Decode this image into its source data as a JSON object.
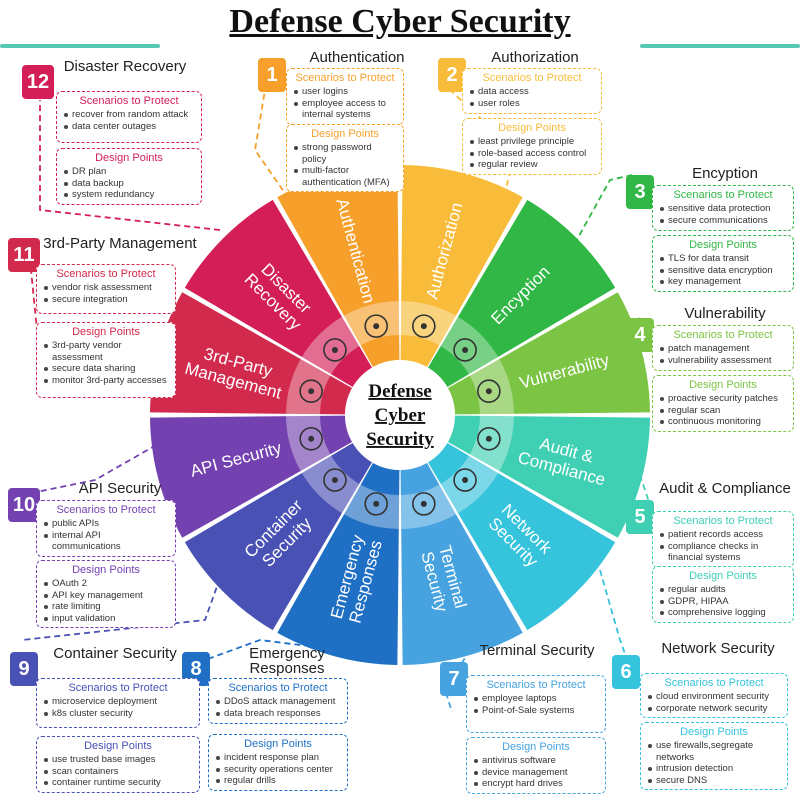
{
  "title": "Defense Cyber Security",
  "center_label": [
    "Defense",
    "Cyber",
    "Security"
  ],
  "sections": [
    {
      "num": "1",
      "name": "Authentication",
      "wheel": [
        "Authentication"
      ],
      "color": "#f6a02b",
      "scenarios_label": "Scenarios to Protect",
      "scenarios": [
        "user logins",
        "employee access to internal systems"
      ],
      "design_label": "Design Points",
      "design": [
        "strong password policy",
        "multi-factor authentication (MFA)"
      ]
    },
    {
      "num": "2",
      "name": "Authorization",
      "wheel": [
        "Authorization"
      ],
      "color": "#f8bc3a",
      "scenarios_label": "Scenarios to Protect",
      "scenarios": [
        "data access",
        "user roles"
      ],
      "design_label": "Design Points",
      "design": [
        "least privilege principle",
        "role-based access control",
        "regular review"
      ]
    },
    {
      "num": "3",
      "name": "Encyption",
      "wheel": [
        "Encyption"
      ],
      "color": "#30b745",
      "scenarios_label": "Scenarios to Protect",
      "scenarios": [
        "sensitive data protection",
        "secure communications"
      ],
      "design_label": "Design Points",
      "design": [
        "TLS for data transit",
        "sensitive data encryption",
        "key management"
      ]
    },
    {
      "num": "4",
      "name": "Vulnerability",
      "wheel": [
        "Vulnerability"
      ],
      "color": "#7cc443",
      "scenarios_label": "Scenarios to Protect",
      "scenarios": [
        "patch management",
        "vulnerability assessment"
      ],
      "design_label": "Design Points",
      "design": [
        "proactive security patches",
        "regular scan",
        "continuous monitoring"
      ]
    },
    {
      "num": "5",
      "name": "Audit & Compliance",
      "wheel": [
        "Audit &",
        "Compliance"
      ],
      "color": "#3fcfb3",
      "scenarios_label": "Scenarios to Protect",
      "scenarios": [
        "patient records access",
        "compliance checks in financial systems"
      ],
      "design_label": "Design Points",
      "design": [
        "regular audits",
        "GDPR, HIPAA",
        "comprehensive logging"
      ]
    },
    {
      "num": "6",
      "name": "Network Security",
      "wheel": [
        "Network",
        "Security"
      ],
      "color": "#36c3dc",
      "scenarios_label": "Scenarios to Protect",
      "scenarios": [
        "cloud environment security",
        "corporate network security"
      ],
      "design_label": "Design Points",
      "design": [
        "use firewalls,segregate networks",
        "intrusion detection",
        "secure DNS"
      ]
    },
    {
      "num": "7",
      "name": "Terminal Security",
      "wheel": [
        "Terminal",
        "Security"
      ],
      "color": "#46a3e0",
      "scenarios_label": "Scenarios to Protect",
      "scenarios": [
        "employee laptops",
        "Point-of-Sale systems"
      ],
      "design_label": "Design Points",
      "design": [
        "antivirus software",
        "device management",
        "encrypt hard drives"
      ]
    },
    {
      "num": "8",
      "name": "Emergency Responses",
      "wheel": [
        "Emergency",
        "Responses"
      ],
      "color": "#1f6fc4",
      "scenarios_label": "Scenarios to Protect",
      "scenarios": [
        "DDoS attack management",
        "data breach responses"
      ],
      "design_label": "Design Points",
      "design": [
        "incident response plan",
        "security operations center",
        "regular drills"
      ]
    },
    {
      "num": "9",
      "name": "Container Security",
      "wheel": [
        "Container",
        "Security"
      ],
      "color": "#4a51b5",
      "scenarios_label": "Scenarios to Protect",
      "scenarios": [
        "microservice deployment",
        "k8s cluster security"
      ],
      "design_label": "Design Points",
      "design": [
        "use trusted base images",
        "scan containers",
        "container runtime security"
      ]
    },
    {
      "num": "10",
      "name": "API Security",
      "wheel": [
        "API Security"
      ],
      "color": "#7442b0",
      "scenarios_label": "Scenarios to Protect",
      "scenarios": [
        "public APIs",
        "internal API communications"
      ],
      "design_label": "Design Points",
      "design": [
        "OAuth 2",
        "API key management",
        "rate limiting",
        "input validation"
      ]
    },
    {
      "num": "11",
      "name": "3rd-Party Management",
      "wheel": [
        "3rd-Party",
        "Management"
      ],
      "color": "#d22a4d",
      "scenarios_label": "Scenarios to Protect",
      "scenarios": [
        "vendor risk assessment",
        "secure integration"
      ],
      "design_label": "Design Points",
      "design": [
        "3rd-party vendor assessment",
        "secure data sharing",
        "monitor 3rd-party accesses"
      ]
    },
    {
      "num": "12",
      "name": "Disaster Recovery",
      "wheel": [
        "Disaster",
        "Recovery"
      ],
      "color": "#d31e58",
      "scenarios_label": "Scenarios to Protect",
      "scenarios": [
        "recover from random attack",
        "data center outages"
      ],
      "design_label": "Design Points",
      "design": [
        "DR plan",
        "data backup",
        "system redundancy"
      ]
    }
  ]
}
